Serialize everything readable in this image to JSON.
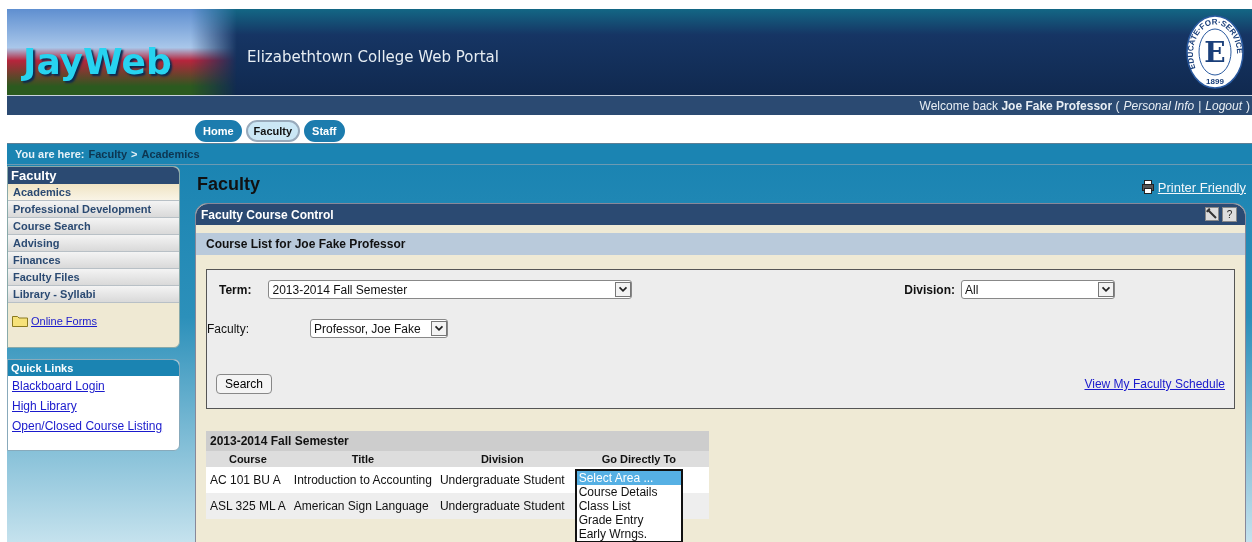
{
  "header": {
    "logo": "JayWeb",
    "title": "Elizabethtown College Web Portal",
    "seal": {
      "letter": "E",
      "ring": "EDUCATE·FOR·SERVICE",
      "year": "1899"
    }
  },
  "welcome": {
    "prefix": "Welcome back",
    "name": "Joe Fake Professor",
    "open": "(",
    "links": [
      "Personal Info",
      "Logout"
    ],
    "separator": "|",
    "close": ")"
  },
  "tabs": [
    {
      "label": "Home",
      "selected": false
    },
    {
      "label": "Faculty",
      "selected": true
    },
    {
      "label": "Staff",
      "selected": false
    }
  ],
  "breadcrumb": {
    "label": "You are here:",
    "items": [
      "Faculty",
      "Academics"
    ],
    "separator": ">"
  },
  "sidebar": {
    "title": "Faculty",
    "items": [
      {
        "label": "Academics",
        "selected": true
      },
      {
        "label": "Professional Development",
        "selected": false
      },
      {
        "label": "Course Search",
        "selected": false
      },
      {
        "label": "Advising",
        "selected": false
      },
      {
        "label": "Finances",
        "selected": false
      },
      {
        "label": "Faculty Files",
        "selected": false
      },
      {
        "label": "Library - Syllabi",
        "selected": false
      }
    ],
    "folder_link": "Online Forms"
  },
  "quick_links": {
    "title": "Quick Links",
    "items": [
      "Blackboard Login",
      "High Library",
      "Open/Closed Course Listing"
    ]
  },
  "page_title": "Faculty",
  "printer_link": "Printer Friendly",
  "portlet": {
    "title": "Faculty Course Control",
    "help": "?",
    "subtitle": "Course List for Joe Fake Professor",
    "form": {
      "term_label": "Term:",
      "term_value": "2013-2014 Fall Semester",
      "division_label": "Division:",
      "division_value": "All",
      "faculty_label": "Faculty:",
      "faculty_value": "Professor, Joe Fake",
      "search_button": "Search",
      "schedule_link": "View My Faculty Schedule"
    },
    "table": {
      "caption": "2013-2014 Fall Semester",
      "columns": [
        "Course",
        "Title",
        "Division",
        "Go Directly To"
      ],
      "rows": [
        {
          "course": "AC 101 BU A",
          "title": "Introduction to Accounting",
          "division": "Undergraduate Student"
        },
        {
          "course": "ASL 325 ML A",
          "title": "American Sign Language",
          "division": "Undergraduate Student"
        }
      ],
      "dropdown_options": [
        {
          "label": "Select Area ...",
          "selected": true
        },
        {
          "label": "Course Details",
          "selected": false
        },
        {
          "label": "Class List",
          "selected": false
        },
        {
          "label": "Grade Entry",
          "selected": false
        },
        {
          "label": "Early Wrngs.",
          "selected": false
        }
      ]
    }
  }
}
